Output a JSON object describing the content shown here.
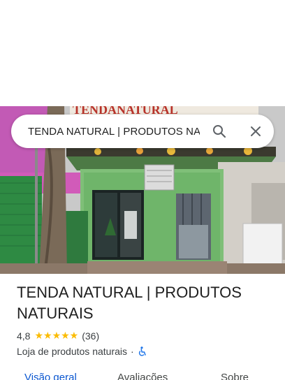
{
  "search": {
    "query": "TENDA NATURAL | PRODUTOS NATURAIS"
  },
  "hero": {
    "storefront_sign": "TENDANATURAL"
  },
  "place": {
    "name": "TENDA NATURAL | PRODUTOS NATURAIS",
    "rating": "4,8",
    "stars": "★★★★★",
    "review_count": "(36)",
    "category": "Loja de produtos naturais",
    "separator": "·"
  },
  "tabs": [
    {
      "label": "Visão geral"
    },
    {
      "label": "Avaliações"
    },
    {
      "label": "Sobre"
    }
  ],
  "colors": {
    "accent": "#0b57d0",
    "star": "#fbbc04",
    "accessibility": "#1a73e8"
  }
}
